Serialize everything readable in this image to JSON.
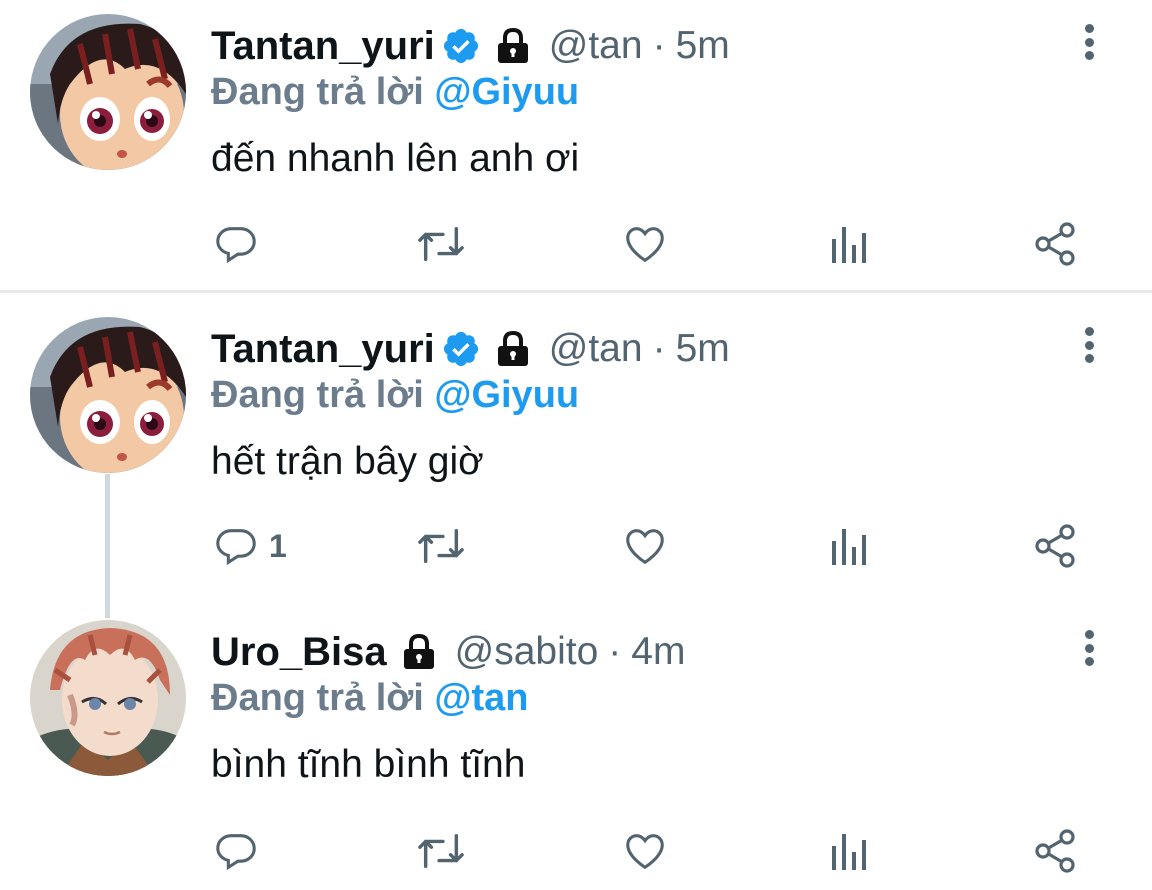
{
  "tweets": [
    {
      "name": "Tantan_yuri",
      "verified": true,
      "locked": true,
      "handle": "@tan",
      "separator": "·",
      "time": "5m",
      "replying_prefix": "Đang trả lời",
      "replying_to": "@Giyuu",
      "text": "đến nhanh lên anh ơi",
      "reply_count": ""
    },
    {
      "name": "Tantan_yuri",
      "verified": true,
      "locked": true,
      "handle": "@tan",
      "separator": "·",
      "time": "5m",
      "replying_prefix": "Đang trả lời",
      "replying_to": "@Giyuu",
      "text": "hết trận bây giờ",
      "reply_count": "1"
    },
    {
      "name": "Uro_Bisa",
      "verified": false,
      "locked": true,
      "handle": "@sabito",
      "separator": "·",
      "time": "4m",
      "replying_prefix": "Đang trả lời",
      "replying_to": "@tan",
      "text": "bình tĩnh bình tĩnh",
      "reply_count": ""
    }
  ],
  "icons": {
    "actions": [
      "reply-icon",
      "retweet-icon",
      "like-icon",
      "views-icon",
      "share-icon"
    ],
    "badges": [
      "verified-badge-icon",
      "lock-icon"
    ]
  },
  "colors": {
    "accent": "#1d9bf0",
    "secondary_text": "#536471",
    "replying_text": "#6b7d8c",
    "divider": "#e7e9ea"
  }
}
